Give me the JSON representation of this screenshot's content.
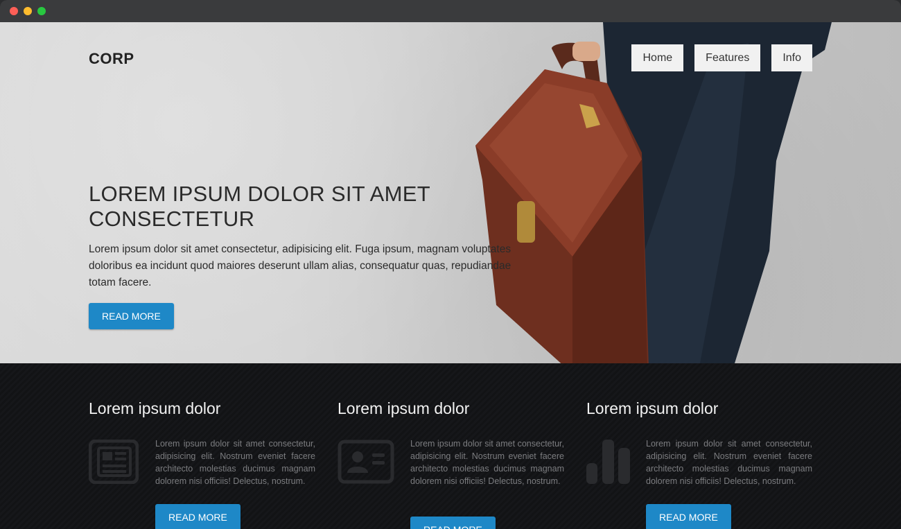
{
  "brand": "CORP",
  "nav": [
    "Home",
    "Features",
    "Info"
  ],
  "hero": {
    "title": "LOREM IPSUM DOLOR SIT AMET CONSECTETUR",
    "text": "Lorem ipsum dolor sit amet consectetur, adipisicing elit. Fuga ipsum, magnam voluptates doloribus ea incidunt quod maiores deserunt ullam alias, consequatur quas, repudiandae totam facere.",
    "button": "READ MORE"
  },
  "features": [
    {
      "title": "Lorem ipsum dolor",
      "icon": "newspaper-icon",
      "text": "Lorem ipsum dolor sit amet consectetur, adipisicing elit. Nostrum eveniet facere architecto molestias ducimus magnam dolorem nisi officiis! Delectus, nostrum.",
      "button": "READ MORE"
    },
    {
      "title": "Lorem ipsum dolor",
      "icon": "id-card-icon",
      "text": "Lorem ipsum dolor sit amet consectetur, adipisicing elit. Nostrum eveniet facere architecto molestias ducimus magnam dolorem nisi officiis! Delectus, nostrum.",
      "button": "READ MORE"
    },
    {
      "title": "Lorem ipsum dolor",
      "icon": "bar-chart-icon",
      "text": "Lorem ipsum dolor sit amet consectetur, adipisicing elit. Nostrum eveniet facere architecto molestias ducimus magnam dolorem nisi officiis! Delectus, nostrum.",
      "button": "READ MORE"
    }
  ],
  "colors": {
    "accent": "#1e88c7",
    "dark": "#121315"
  }
}
